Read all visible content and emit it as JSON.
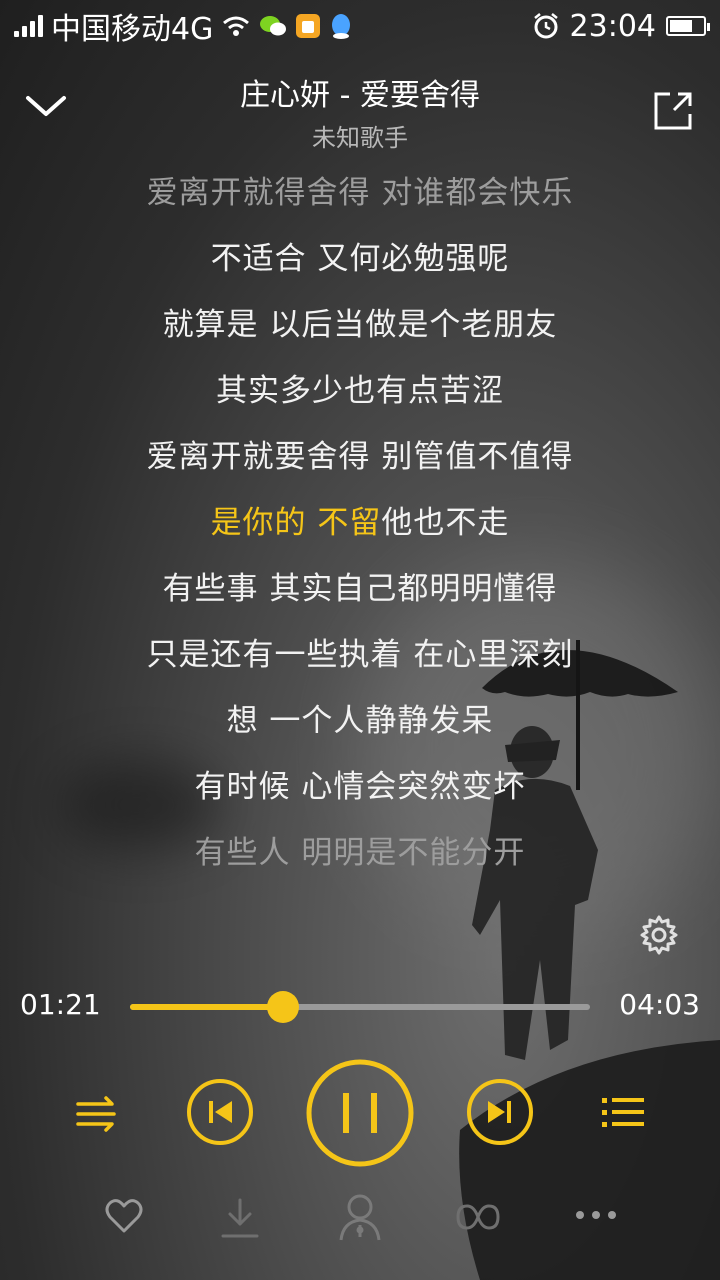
{
  "status_bar": {
    "carrier": "中国移动4G",
    "time": "23:04"
  },
  "header": {
    "title": "庄心妍 - 爱要舍得",
    "artist": "未知歌手"
  },
  "lyrics": {
    "lines": [
      "爱离开就得舍得 对谁都会快乐",
      "不适合 又何必勉强呢",
      "就算是 以后当做是个老朋友",
      "其实多少也有点苦涩",
      "爱离开就要舍得 别管值不值得",
      "是你的 不留他也不走",
      "有些事 其实自己都明明懂得",
      "只是还有一些执着 在心里深刻",
      "想 一个人静静发呆",
      "有时候 心情会突然变坏",
      "有些人 明明是不能分开"
    ],
    "current_index": 5,
    "current_highlight": "是你的 不留",
    "current_rest": "他也不走"
  },
  "progress": {
    "elapsed": "01:21",
    "total": "04:03",
    "fraction": 0.333
  },
  "icons": {
    "collapse": "chevron-down-icon",
    "share": "share-icon",
    "settings": "gear-icon",
    "shuffle": "shuffle-icon",
    "previous": "previous-icon",
    "pause": "pause-icon",
    "next": "next-icon",
    "playlist": "playlist-icon",
    "favorite": "heart-icon",
    "download": "download-icon",
    "singer": "singer-icon",
    "effect": "sound-effect-icon",
    "more": "more-icon"
  },
  "colors": {
    "accent": "#f5c518",
    "text": "#ffffff",
    "dim_text": "#9d9d9d",
    "icon_gray": "#9a9a9a"
  }
}
